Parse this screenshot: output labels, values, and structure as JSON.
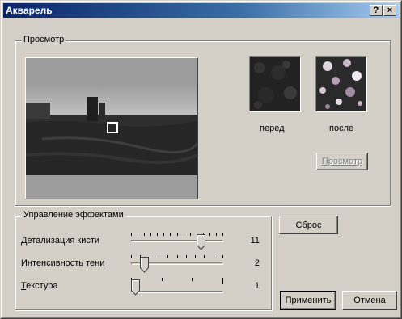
{
  "window": {
    "title": "Акварель",
    "help_button": "?",
    "close_button": "×"
  },
  "preview_group": {
    "label": "Просмотр",
    "before_label": "перед",
    "after_label": "после",
    "preview_button": "Просмотр"
  },
  "effects_group": {
    "label": "Управление эффектами",
    "sliders": [
      {
        "accel": "Д",
        "rest": "етализация кисти",
        "value": "11",
        "level": 11,
        "max": 14
      },
      {
        "accel": "И",
        "rest": "нтенсивность тени",
        "value": "2",
        "level": 2,
        "max": 10
      },
      {
        "accel": "Т",
        "rest": "екстура",
        "value": "1",
        "level": 1,
        "max": 10
      }
    ]
  },
  "buttons": {
    "reset": "Сброс",
    "apply_accel": "П",
    "apply_rest": "рименить",
    "cancel": "Отмена"
  }
}
